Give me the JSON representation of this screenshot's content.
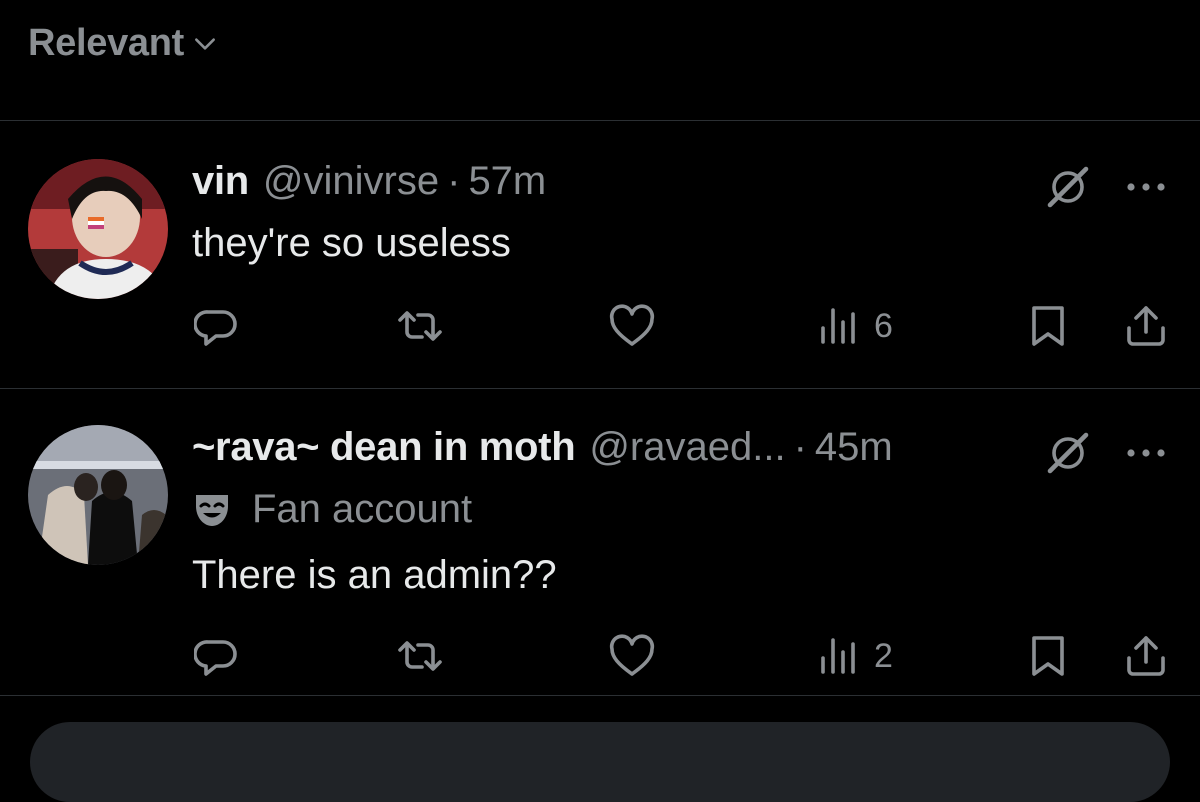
{
  "sort": {
    "label": "Relevant",
    "icon": "chevron-down-icon"
  },
  "colors": {
    "background": "#000000",
    "text_primary": "#e7e9ea",
    "text_secondary": "#8b8f93",
    "divider": "#2b2f33"
  },
  "tweets": [
    {
      "display_name": "vin",
      "handle": "@vinivrse",
      "separator": "·",
      "time": "57m",
      "badge": "",
      "text": "they're so useless",
      "views": "6"
    },
    {
      "display_name": "~rava~ dean in moth",
      "handle": "@ravaed...",
      "separator": "·",
      "time": "45m",
      "badge": "Fan account",
      "text": "There is an admin??",
      "views": "2"
    }
  ]
}
